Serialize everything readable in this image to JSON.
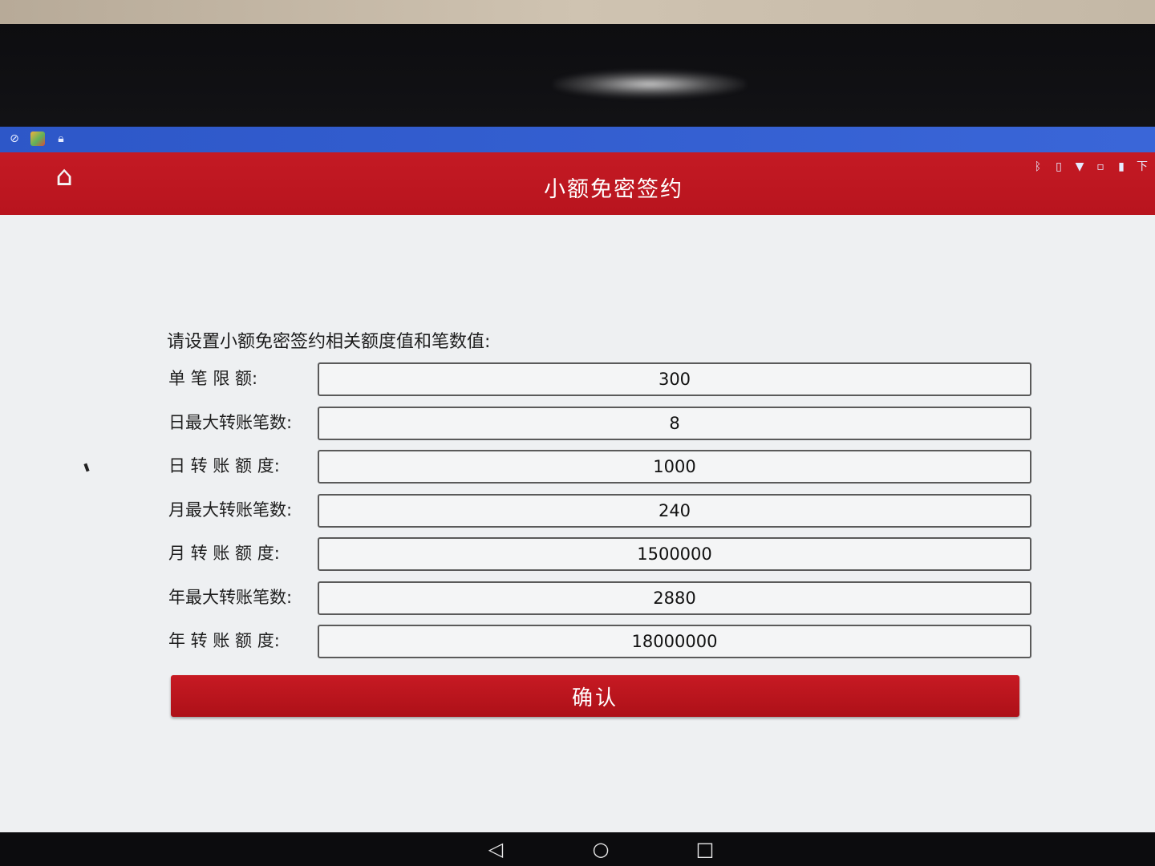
{
  "status_bar": {
    "left_icons": [
      "sync-icon",
      "gallery-app-icon",
      "lock-icon"
    ],
    "right_icons": [
      "bluetooth-icon",
      "vibrate-icon",
      "wifi-icon",
      "sim-icon",
      "battery-icon"
    ],
    "right_text": "下"
  },
  "app_bar": {
    "title": "小额免密签约",
    "home_icon": "home-icon"
  },
  "form": {
    "instruction": "请设置小额免密签约相关额度值和笔数值:",
    "fields": [
      {
        "label": "单 笔 限 额:",
        "value": "300"
      },
      {
        "label": "日最大转账笔数:",
        "value": "8"
      },
      {
        "label": "日 转 账 额 度:",
        "value": "1000"
      },
      {
        "label": "月最大转账笔数:",
        "value": "240"
      },
      {
        "label": "月 转 账 额 度:",
        "value": "1500000"
      },
      {
        "label": "年最大转账笔数:",
        "value": "2880"
      },
      {
        "label": "年 转 账 额 度:",
        "value": "18000000"
      }
    ],
    "confirm_label": "确认"
  },
  "nav_bar": {
    "icons": [
      "back-icon",
      "home-circle-icon",
      "recents-icon"
    ]
  },
  "colors": {
    "app_bar": "#c41a24",
    "status_bar": "#3a66d8",
    "confirm_button": "#c71a23"
  }
}
